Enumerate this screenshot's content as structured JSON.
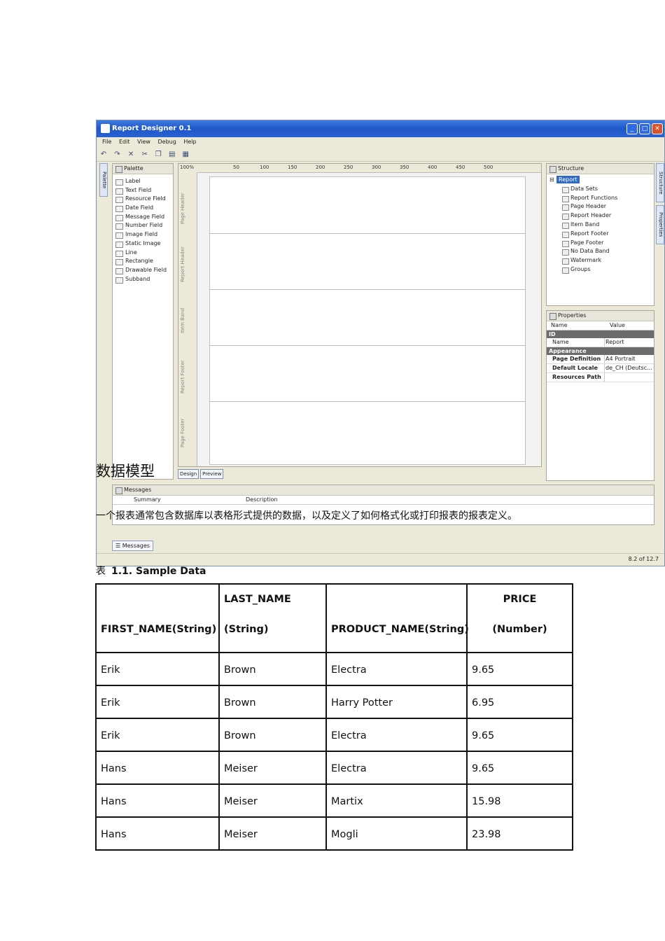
{
  "screenshot": {
    "title": "Report Designer 0.1",
    "menu": [
      "File",
      "Edit",
      "View",
      "Debug",
      "Help"
    ],
    "toolbar_icons": [
      "undo-icon",
      "redo-icon",
      "delete-icon",
      "cut-icon",
      "copy-icon",
      "paste-icon",
      "grid-icon"
    ],
    "palette": {
      "tab": "Palette",
      "title": "Palette",
      "items": [
        "Label",
        "Text Field",
        "Resource Field",
        "Date Field",
        "Message Field",
        "Number Field",
        "Image Field",
        "Static Image",
        "Line",
        "Rectangle",
        "Drawable Field",
        "Subband"
      ]
    },
    "ruler": {
      "zoom": "100%",
      "ticks": [
        "50",
        "100",
        "150",
        "200",
        "250",
        "300",
        "350",
        "400",
        "450",
        "500"
      ]
    },
    "bands": [
      "Page Header",
      "Report Header",
      "Item Band",
      "Report Footer",
      "Page Footer"
    ],
    "canvas_tabs": [
      "Design",
      "Preview"
    ],
    "structure": {
      "title": "Structure",
      "root": "Report",
      "items": [
        "Data Sets",
        "Report Functions",
        "Page Header",
        "Report Header",
        "Item Band",
        "Report Footer",
        "Page Footer",
        "No Data Band",
        "Watermark",
        "Groups"
      ]
    },
    "side_tabs": [
      "Structure",
      "Properties"
    ],
    "properties": {
      "title": "Properties",
      "col_name": "Name",
      "col_value": "Value",
      "group_id": "ID",
      "name_key": "Name",
      "name_value": "Report",
      "group_appearance": "Appearance",
      "rows": [
        {
          "key": "Page Definition",
          "value": "A4 Portrait"
        },
        {
          "key": "Default Locale",
          "value": "de_CH (Deutsc..."
        },
        {
          "key": "Resources Path",
          "value": ""
        }
      ]
    },
    "messages": {
      "title": "Messages",
      "col_summary": "Summary",
      "col_description": "Description",
      "tab": "Messages"
    },
    "status": "8.2 of 12.7"
  },
  "doc": {
    "heading": "数据模型",
    "paragraph": "一个报表通常包含数据库以表格形式提供的数据，以及定义了如何格式化或打印报表的报表定义。",
    "caption_prefix": "表",
    "caption_title": "1.1. Sample Data"
  },
  "table": {
    "headers": [
      [
        "",
        "FIRST_NAME(String)"
      ],
      [
        "LAST_NAME",
        "(String)"
      ],
      [
        "PRODUCT_NAME(String)",
        ""
      ],
      [
        "PRICE",
        "(Number)"
      ]
    ],
    "rows": [
      [
        "Erik",
        "Brown",
        "Electra",
        "9.65"
      ],
      [
        "Erik",
        "Brown",
        "Harry Potter",
        "6.95"
      ],
      [
        "Erik",
        "Brown",
        "Electra",
        "9.65"
      ],
      [
        "Hans",
        "Meiser",
        "Electra",
        "9.65"
      ],
      [
        "Hans",
        "Meiser",
        "Martix",
        "15.98"
      ],
      [
        "Hans",
        "Meiser",
        "Mogli",
        "23.98"
      ]
    ]
  }
}
